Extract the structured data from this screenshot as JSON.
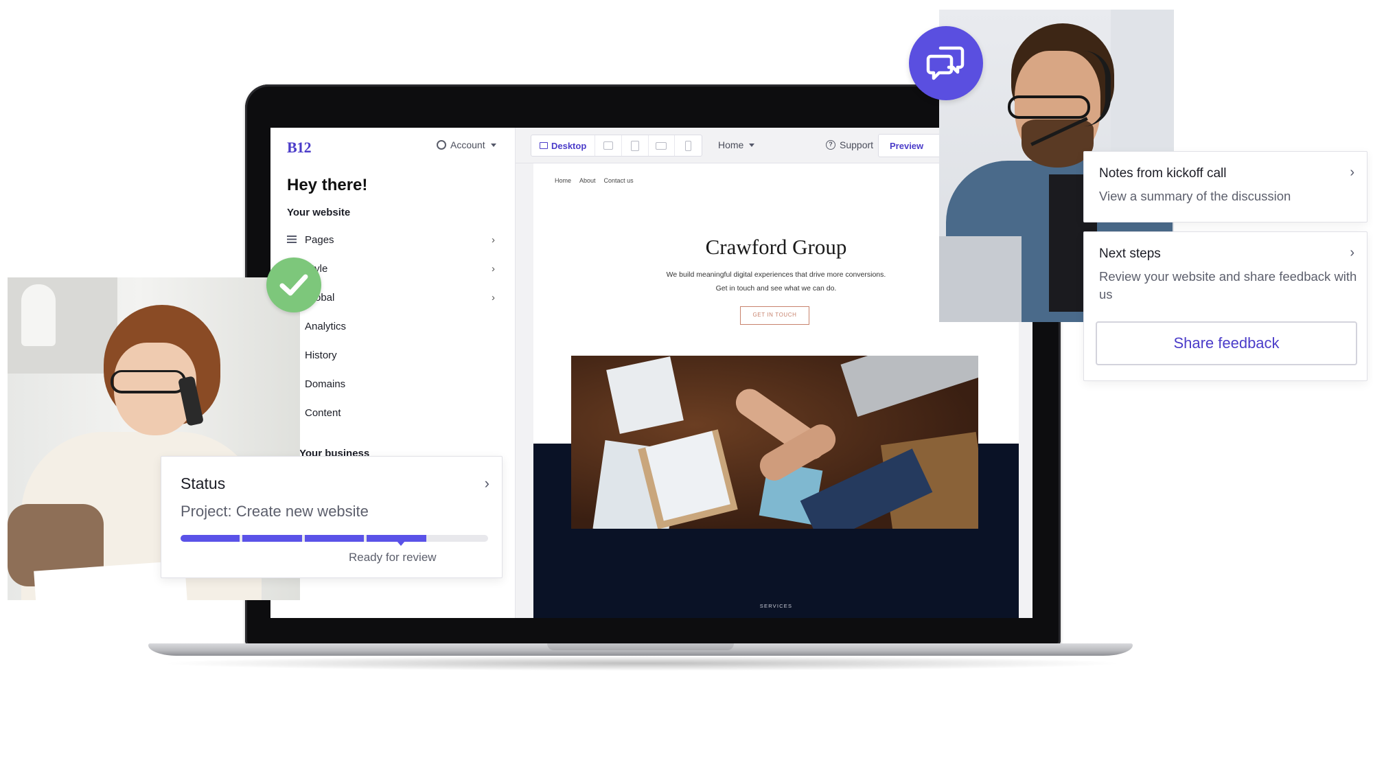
{
  "editor": {
    "logo": "B12",
    "account_label": "Account",
    "greeting": "Hey there!",
    "section_title": "Your website",
    "menu": [
      {
        "label": "Pages",
        "chevron": true
      },
      {
        "label": "Style",
        "chevron": true
      },
      {
        "label": "Global",
        "chevron": true
      },
      {
        "label": "Analytics",
        "chevron": false
      },
      {
        "label": "History",
        "chevron": false
      },
      {
        "label": "Domains",
        "chevron": false
      },
      {
        "label": "Content",
        "chevron": false
      }
    ],
    "section2_title": "Your business"
  },
  "toolbar": {
    "device_active": "Desktop",
    "page_select": "Home",
    "support_label": "Support",
    "preview_label": "Preview"
  },
  "site": {
    "nav": [
      "Home",
      "About",
      "Contact us"
    ],
    "title": "Crawford Group",
    "subtitle": "We build meaningful digital experiences that drive more conversions. Get in touch and see what we can do.",
    "cta": "GET IN TOUCH",
    "section_label": "SERVICES"
  },
  "status_card": {
    "title": "Status",
    "project": "Project: Create new website",
    "progress_segments_completed": 4,
    "progress_segments_total": 5,
    "status_text": "Ready for review"
  },
  "cards": {
    "kickoff": {
      "title": "Notes from kickoff call",
      "subtitle": "View a summary of the discussion"
    },
    "next_steps": {
      "title": "Next steps",
      "subtitle": "Review your website and share feedback with us",
      "button": "Share feedback"
    }
  },
  "icons": {
    "check_badge": "check-icon",
    "chat_badge": "chat-bubbles-icon"
  },
  "colors": {
    "accent": "#4b3cc9",
    "progress": "#5a52e8",
    "check_green": "#7dc77b",
    "chat_purple": "#5a4fe0",
    "site_navy": "#0a1226",
    "cta_outline": "#c7826c"
  }
}
